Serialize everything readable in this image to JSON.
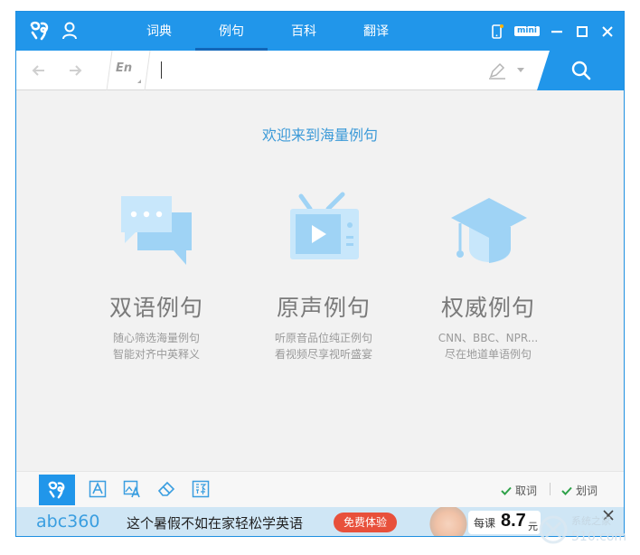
{
  "titlebar": {
    "tabs": [
      {
        "label": "词典"
      },
      {
        "label": "例句"
      },
      {
        "label": "百科"
      },
      {
        "label": "翻译"
      }
    ],
    "mini_label": "mini"
  },
  "searchbar": {
    "lang_label": "En",
    "query": "",
    "placeholder": ""
  },
  "main": {
    "welcome": "欢迎来到海量例句",
    "features": [
      {
        "title": "双语例句",
        "desc1": "随心筛选海量例句",
        "desc2": "智能对齐中英释义",
        "icon": "chat-bubbles-icon"
      },
      {
        "title": "原声例句",
        "desc1": "听原音品位纯正例句",
        "desc2": "看视频尽享视听盛宴",
        "icon": "tv-play-icon"
      },
      {
        "title": "权威例句",
        "desc1": "CNN、BBC、NPR...",
        "desc2": "尽在地道单语例句",
        "icon": "graduation-cap-icon"
      }
    ]
  },
  "bottombar": {
    "opt_quci": "取词",
    "opt_huaci": "划词"
  },
  "ad": {
    "brand": "abc360",
    "slogan": "这个暑假不如在家轻松学英语",
    "cta": "免费体验",
    "price_label": "每课",
    "price": "8.7",
    "price_unit": "元",
    "watermark": "系统之家"
  },
  "colors": {
    "brand_blue": "#2196ea",
    "welcome_blue": "#3c9ad8",
    "icon_blue": "#9fd3f5",
    "cta_red": "#e8503b"
  }
}
